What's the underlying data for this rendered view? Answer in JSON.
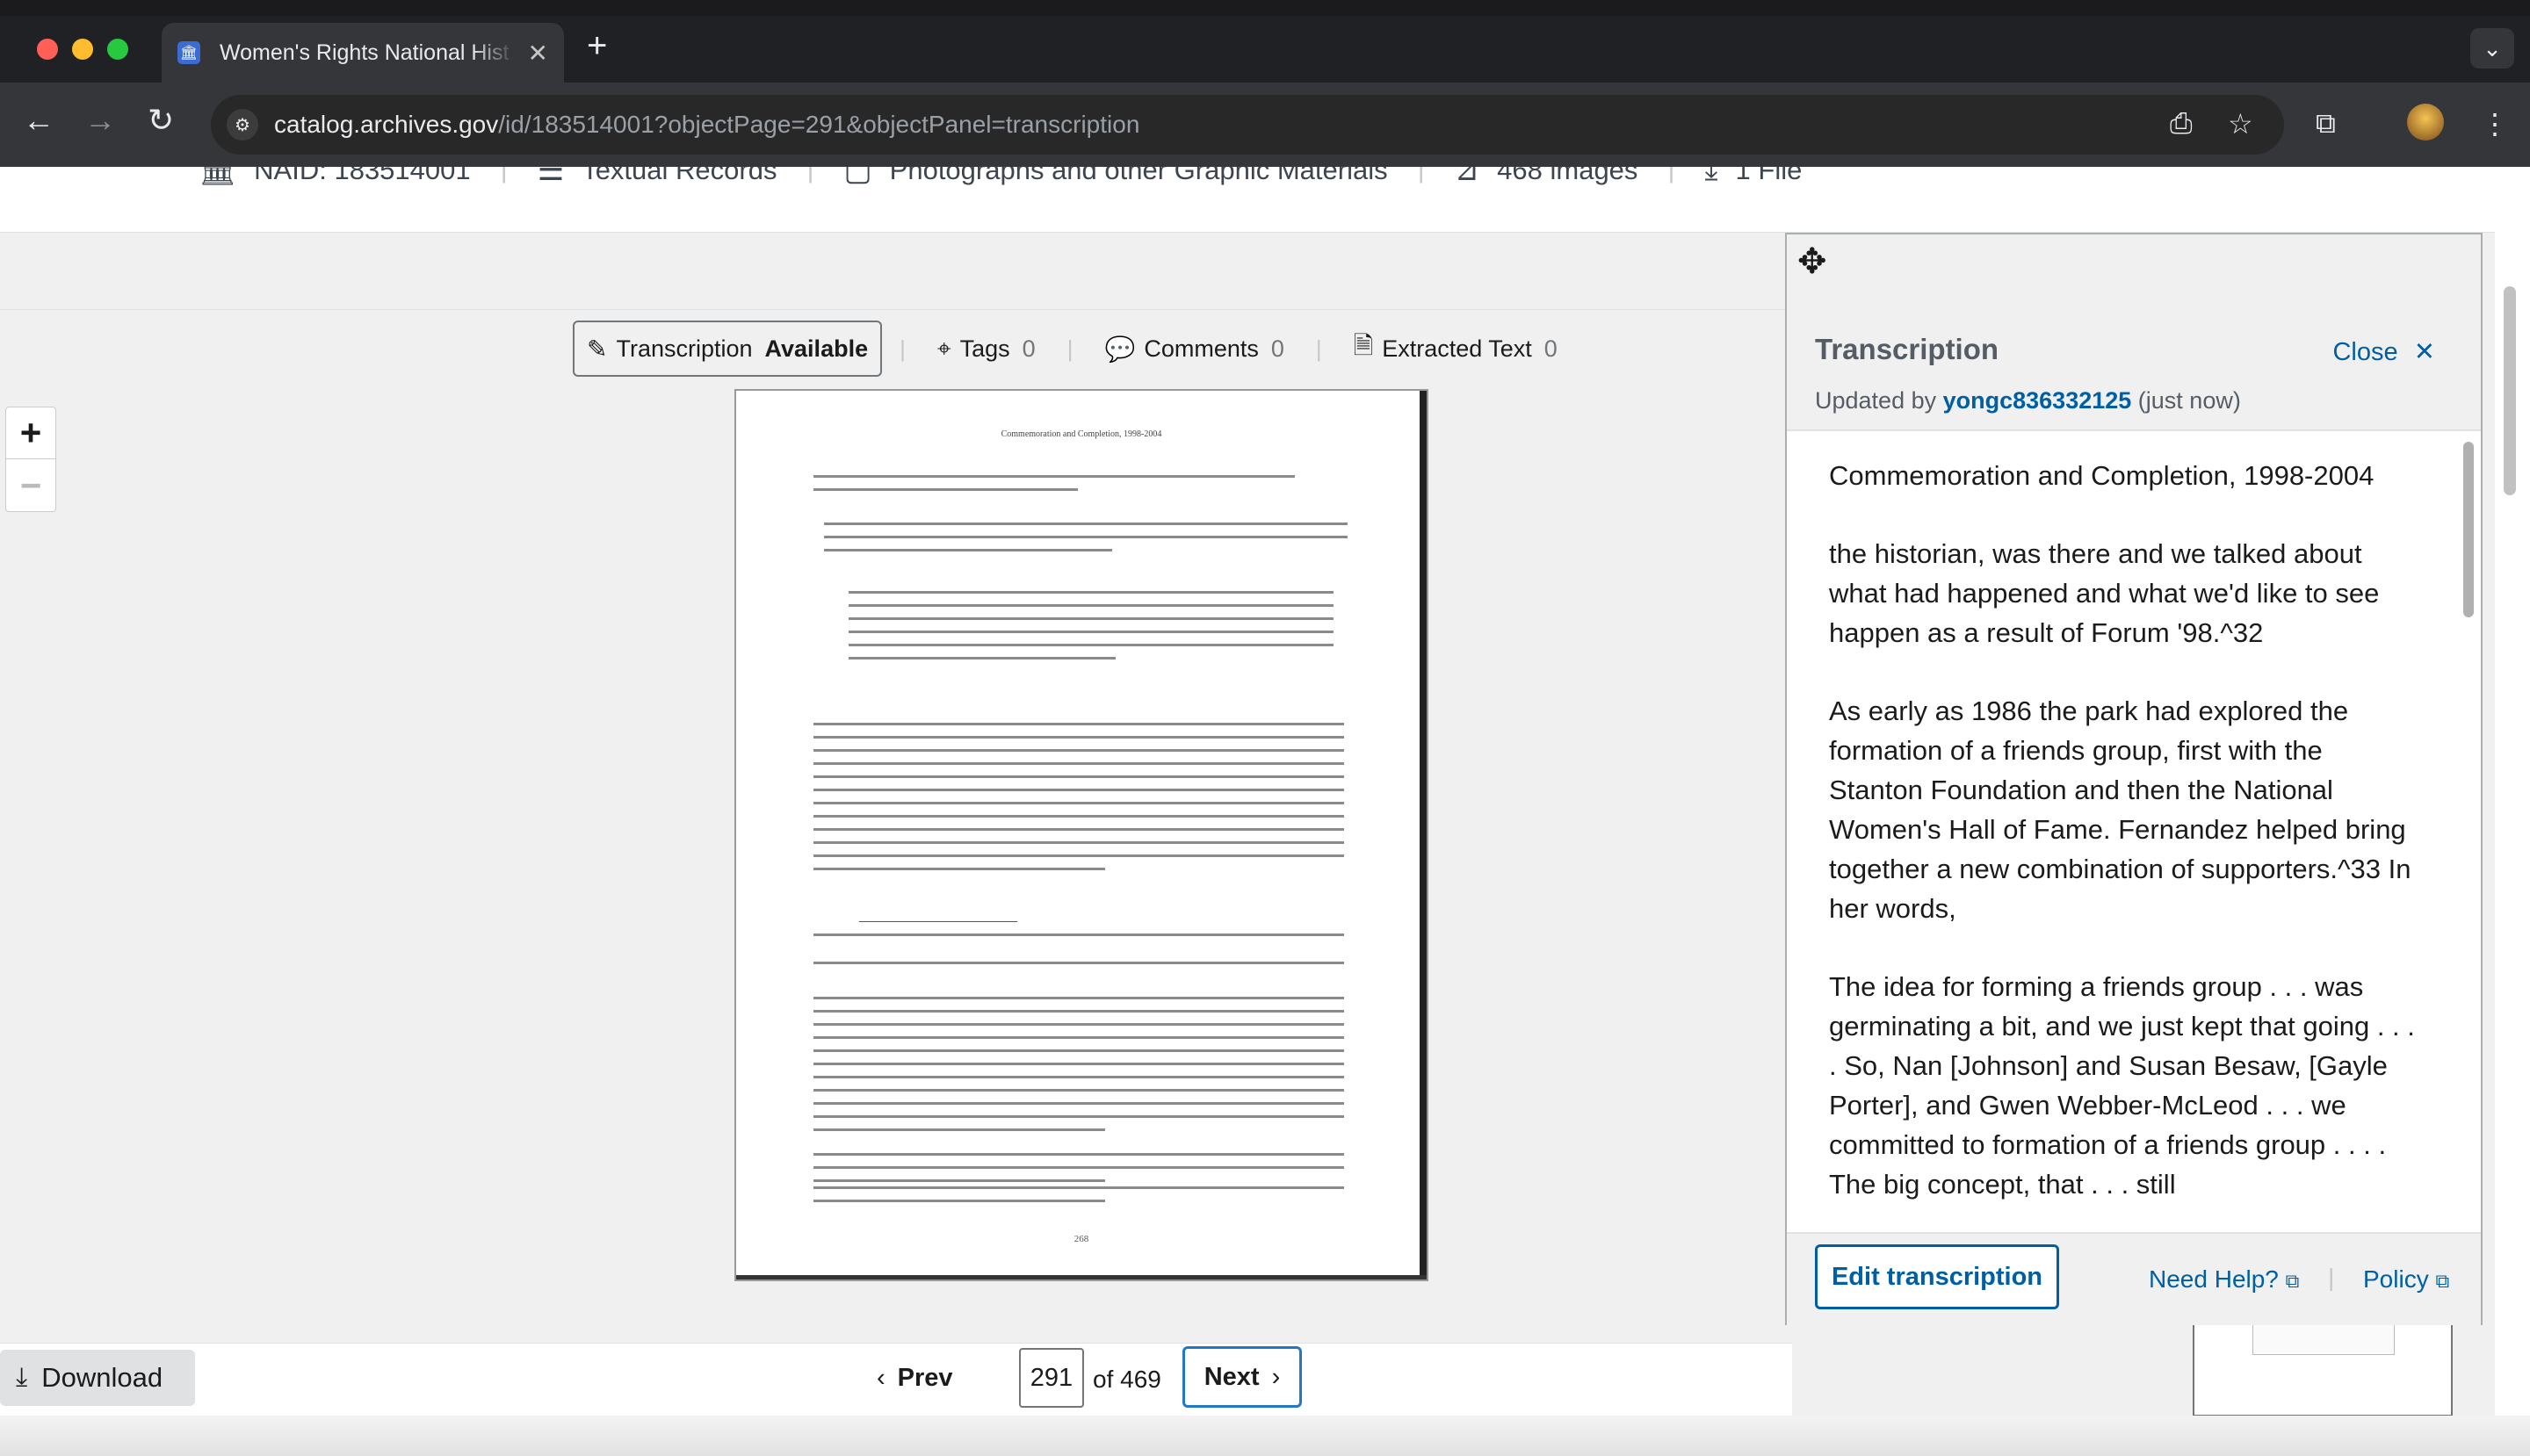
{
  "browser": {
    "tab_title": "Women's Rights National Hist",
    "url_host": "catalog.archives.gov",
    "url_path": "/id/183514001?objectPage=291&objectPanel=transcription"
  },
  "record_meta": {
    "naid": "NAID: 183514001",
    "type1": "Textual Records",
    "type2": "Photographs and other Graphic Materials",
    "images": "468 images",
    "files": "1 File"
  },
  "viewer_actions": [
    {
      "label": "Transcription",
      "count": "Available",
      "icon": "edit-icon"
    },
    {
      "label": "Tags",
      "count": "0",
      "icon": "tag-icon"
    },
    {
      "label": "Comments",
      "count": "0",
      "icon": "comment-icon"
    },
    {
      "label": "Extracted Text",
      "count": "0",
      "icon": "document-icon"
    }
  ],
  "zoom": {
    "in": "+",
    "out": "−"
  },
  "document": {
    "header": "Commemoration and Completion, 1998-2004",
    "page_number": "268"
  },
  "pagination": {
    "download_label": "Download",
    "prev_label": "Prev",
    "current_page": "291",
    "of_total": "of 469",
    "next_label": "Next"
  },
  "transcription_panel": {
    "title": "Transcription",
    "close_label": "Close",
    "updated_prefix": "Updated by",
    "updated_user": "yongc836332125",
    "updated_suffix": "(just now)",
    "paragraphs": [
      "Commemoration and Completion, 1998-2004",
      "the historian, was there and we talked about what had happened and what we'd like to see happen as a result of Forum '98.^32",
      "As early as 1986 the park had explored the formation of a friends group, first with the Stanton Foundation and then the National Women's Hall of Fame. Fernandez helped bring together a new combination of supporters.^33 In her words,",
      "The idea for forming a friends group . . . was germinating a bit, and we just kept that going . . . . So, Nan [Johnson] and Susan Besaw, [Gayle Porter], and Gwen Webber-McLeod . . . we committed to formation of a friends group . . . . The big concept, that . . . still"
    ],
    "edit_label": "Edit transcription",
    "help_label": "Need Help?",
    "policy_label": "Policy"
  },
  "colors": {
    "link": "#005ea2",
    "focus": "#2378c3"
  }
}
